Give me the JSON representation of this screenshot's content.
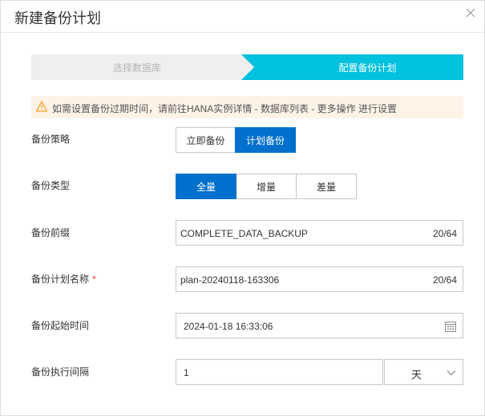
{
  "dialog": {
    "title": "新建备份计划"
  },
  "steps": {
    "step1": "选择数据库",
    "step2": "配置备份计划"
  },
  "alert": {
    "text": "如需设置备份过期时间，请前往HANA实例详情 - 数据库列表 - 更多操作 进行设置"
  },
  "form": {
    "strategy": {
      "label": "备份策略",
      "options": [
        "立即备份",
        "计划备份"
      ],
      "selected": "计划备份"
    },
    "type": {
      "label": "备份类型",
      "options": [
        "全量",
        "增量",
        "差量"
      ],
      "selected": "全量"
    },
    "prefix": {
      "label": "备份前缀",
      "value": "COMPLETE_DATA_BACKUP",
      "count": "20/64"
    },
    "plan_name": {
      "label": "备份计划名称",
      "required_mark": "*",
      "value": "plan-20240118-163306",
      "count": "20/64"
    },
    "start_time": {
      "label": "备份起始时间",
      "value": "2024-01-18 16:33:06"
    },
    "interval": {
      "label": "备份执行间隔",
      "value": "1",
      "unit": "天"
    }
  },
  "icons": {
    "close": "close-icon",
    "warning": "warning-icon",
    "calendar": "calendar-icon",
    "dropdown": "chevron-down-icon"
  },
  "colors": {
    "primary": "#0070cc",
    "active_step": "#00c1de",
    "inactive_step": "#efefef",
    "alert_bg": "#fdf3e7",
    "warning": "#f5a623",
    "required": "#e53935"
  }
}
